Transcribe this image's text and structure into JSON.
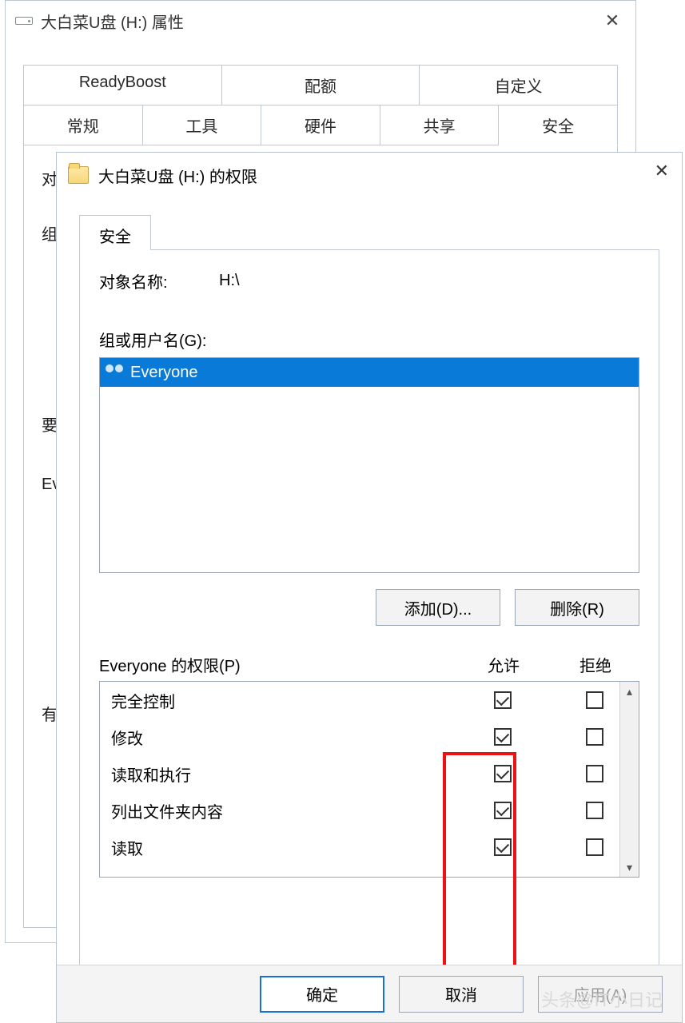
{
  "back_window": {
    "title": "大白菜U盘 (H:) 属性",
    "tabs_top": [
      "ReadyBoost",
      "配额",
      "自定义"
    ],
    "tabs_bottom": [
      "常规",
      "工具",
      "硬件",
      "共享",
      "安全"
    ],
    "active_tab": "安全",
    "body_stubs": [
      "对",
      "组",
      "要",
      "Ev",
      "有"
    ]
  },
  "front_window": {
    "title": "大白菜U盘 (H:) 的权限",
    "tab": "安全",
    "object_label": "对象名称:",
    "object_value": "H:\\",
    "group_label": "组或用户名(G):",
    "users": [
      {
        "name": "Everyone",
        "selected": true
      }
    ],
    "add_button": "添加(D)...",
    "remove_button": "删除(R)",
    "perm_header_left": "Everyone 的权限(P)",
    "col_allow": "允许",
    "col_deny": "拒绝",
    "permissions": [
      {
        "name": "完全控制",
        "allow": true,
        "deny": false
      },
      {
        "name": "修改",
        "allow": true,
        "deny": false
      },
      {
        "name": "读取和执行",
        "allow": true,
        "deny": false
      },
      {
        "name": "列出文件夹内容",
        "allow": true,
        "deny": false
      },
      {
        "name": "读取",
        "allow": true,
        "deny": false
      }
    ],
    "ok": "确定",
    "cancel": "取消",
    "apply": "应用(A)"
  },
  "watermark": "头条@IT小日记"
}
